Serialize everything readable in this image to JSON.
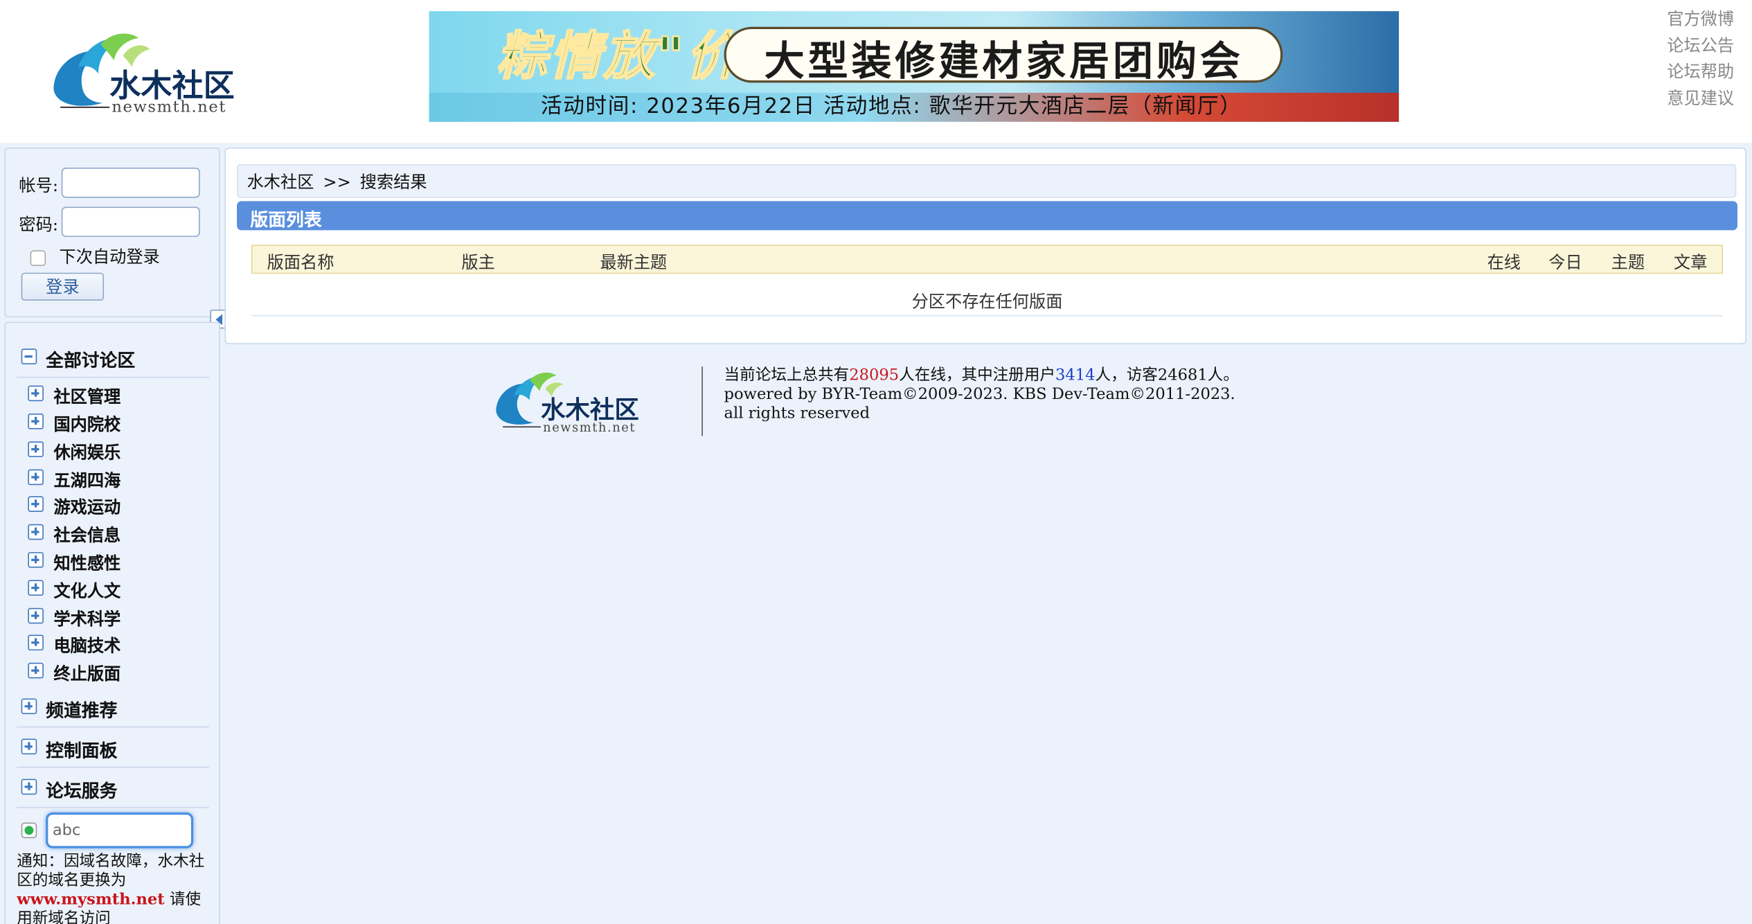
{
  "header": {
    "links": [
      "官方微博",
      "论坛公告",
      "论坛帮助",
      "意见建议"
    ],
    "logo_text": "水木社区",
    "logo_sub": "newsmth.net",
    "banner": {
      "script_title": "粽情放\"价\"",
      "title": "大型装修建材家居团购会",
      "subtitle": "活动时间: 2023年6月22日    活动地点: 歌华开元大酒店二层（新闻厅）"
    }
  },
  "login": {
    "account_label": "帐号:",
    "password_label": "密码:",
    "remember_label": "下次自动登录",
    "login_button": "登录"
  },
  "nav": {
    "all_sections": "全部讨论区",
    "items": [
      "社区管理",
      "国内院校",
      "休闲娱乐",
      "五湖四海",
      "游戏运动",
      "社会信息",
      "知性感性",
      "文化人文",
      "学术科学",
      "电脑技术",
      "终止版面"
    ],
    "channel": "频道推荐",
    "control": "控制面板",
    "services": "论坛服务"
  },
  "search": {
    "value": "abc"
  },
  "notice": {
    "prefix": "通知：因域名故障，水木社区的域名更换为",
    "domain": "www.mysmth.net",
    "suffix": " 请使用新域名访问"
  },
  "main": {
    "breadcrumb": [
      "水木社区",
      ">>",
      "搜索结果"
    ],
    "list_title": "版面列表",
    "columns": [
      "版面名称",
      "版主",
      "最新主题",
      "在线",
      "今日",
      "主题",
      "文章"
    ],
    "empty_message": "分区不存在任何版面"
  },
  "footer": {
    "line1_prefix": "当前论坛上总共有",
    "online_total": "28095",
    "line1_mid": "人在线，其中注册用户",
    "registered": "3414",
    "line1_suffix": "人，访客24681人。",
    "line2": "powered by BYR-Team©2009-2023. KBS Dev-Team©2011-2023.",
    "line3": "all rights reserved"
  },
  "colors": {
    "accent": "#5a8fde",
    "highlight_red": "#c8161d",
    "highlight_blue": "#1a3cc8"
  }
}
